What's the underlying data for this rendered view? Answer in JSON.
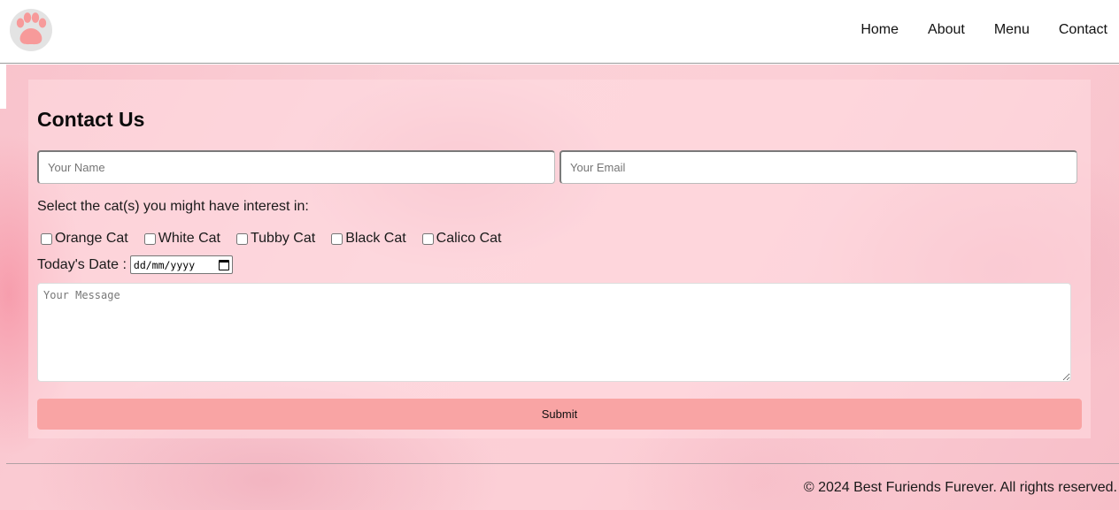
{
  "brand": {
    "logo_icon": "paw-icon",
    "paw_color": "#f79a9a",
    "ring_color": "#e3e3e3"
  },
  "nav": {
    "items": [
      {
        "label": "Home"
      },
      {
        "label": "About"
      },
      {
        "label": "Menu"
      },
      {
        "label": "Contact"
      }
    ]
  },
  "contact": {
    "title": "Contact Us",
    "name_placeholder": "Your Name",
    "email_placeholder": "Your Email",
    "cat_prompt": "Select the cat(s) you might have interest in:",
    "cats": [
      {
        "label": "Orange Cat"
      },
      {
        "label": "White Cat"
      },
      {
        "label": "Tubby Cat"
      },
      {
        "label": "Black Cat"
      },
      {
        "label": "Calico Cat"
      }
    ],
    "date_label": "Today's Date :",
    "date_placeholder": "dd/mm/yyyy",
    "message_placeholder": "Your Message",
    "submit_label": "Submit"
  },
  "colors": {
    "submit_bg": "#f9a4a4",
    "page_bg": "#fbcfd6"
  },
  "footer": {
    "text": "© 2024 Best Furiends Furever. All rights reserved."
  }
}
